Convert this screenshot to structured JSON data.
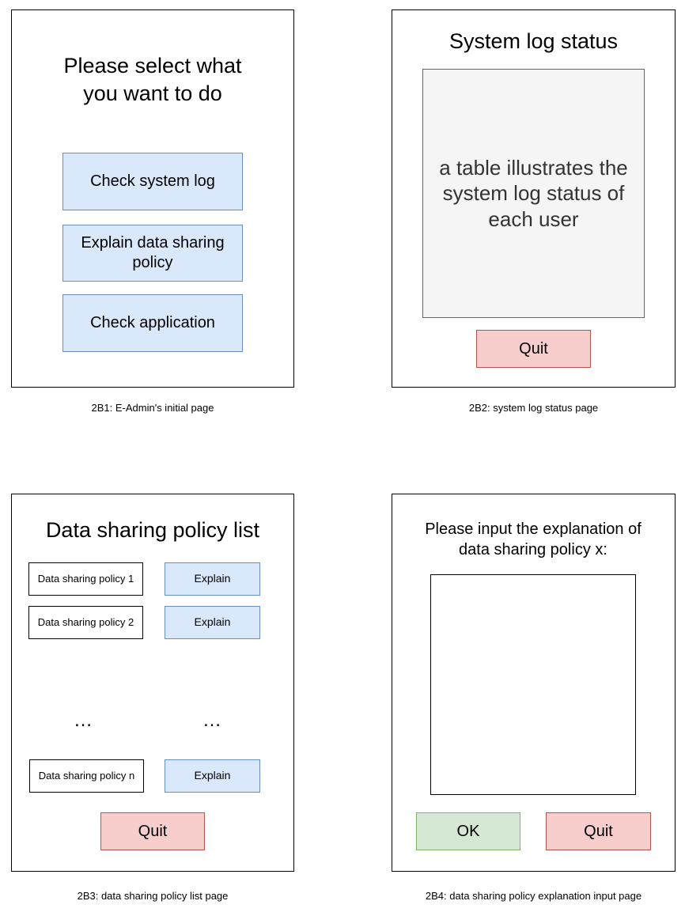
{
  "panels": {
    "p1": {
      "title": "Please select what you want to do",
      "buttons": [
        "Check system log",
        "Explain data sharing policy",
        "Check application"
      ],
      "caption": "2B1: E-Admin's initial page"
    },
    "p2": {
      "title": "System log status",
      "table_placeholder": "a table illustrates the system log status of each user",
      "quit_label": "Quit",
      "caption": "2B2: system log status page"
    },
    "p3": {
      "title": "Data sharing policy list",
      "rows": [
        {
          "policy": "Data sharing policy 1",
          "action": "Explain"
        },
        {
          "policy": "Data sharing policy 2",
          "action": "Explain"
        },
        {
          "policy": "Data sharing policy n",
          "action": "Explain"
        }
      ],
      "ellipsis": "…",
      "quit_label": "Quit",
      "caption": "2B3: data sharing policy list page"
    },
    "p4": {
      "prompt": "Please input the explanation of data sharing policy x:",
      "textarea_value": "",
      "ok_label": "OK",
      "quit_label": "Quit",
      "caption": "2B4: data sharing policy explanation input page"
    }
  },
  "colors": {
    "blue_fill": "#dae8fc",
    "blue_stroke": "#6c8ebf",
    "red_fill": "#f8cecc",
    "red_stroke": "#b85450",
    "green_fill": "#d5e8d4",
    "green_stroke": "#82b366",
    "gray_fill": "#f5f5f5",
    "gray_stroke": "#666666"
  }
}
